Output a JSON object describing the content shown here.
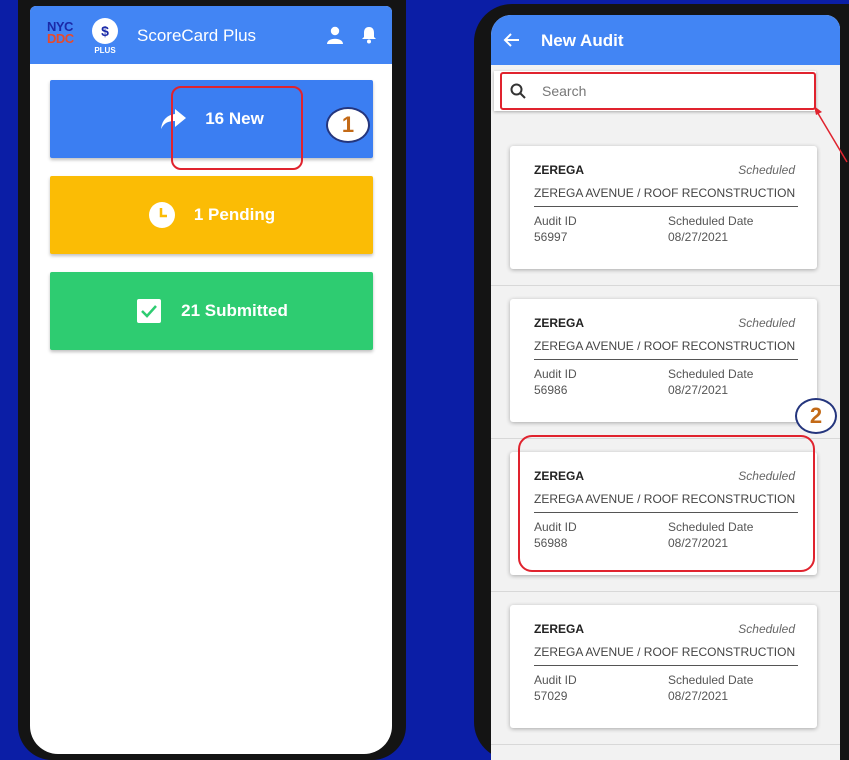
{
  "colors": {
    "background": "#0b1ea6",
    "header_blue": "#4285f4",
    "new_card": "#3b7ef2",
    "pending_card": "#fbbc05",
    "submitted_card": "#2ecc71",
    "callout_red": "#e0232e",
    "badge_number": "#c36a17"
  },
  "left": {
    "logo": {
      "line1": "NYC",
      "line2": "DDC"
    },
    "plus_logo": {
      "mark": "$",
      "label": "PLUS"
    },
    "app_title": "ScoreCard Plus",
    "cards": [
      {
        "icon": "share-arrow-icon",
        "label": "16 New"
      },
      {
        "icon": "clock-icon",
        "label": "1 Pending"
      },
      {
        "icon": "checkbox-icon",
        "label": "21 Submitted"
      }
    ],
    "badge": "1"
  },
  "right": {
    "title": "New Audit",
    "search": {
      "placeholder": "Search",
      "value": ""
    },
    "audits": [
      {
        "name": "ZEREGA",
        "status": "Scheduled",
        "project": "ZEREGA AVENUE / ROOF RECONSTRUCTION",
        "id_label": "Audit ID",
        "id": "56997",
        "date_label": "Scheduled Date",
        "date": "08/27/2021"
      },
      {
        "name": "ZEREGA",
        "status": "Scheduled",
        "project": "ZEREGA AVENUE / ROOF RECONSTRUCTION",
        "id_label": "Audit ID",
        "id": "56986",
        "date_label": "Scheduled Date",
        "date": "08/27/2021"
      },
      {
        "name": "ZEREGA",
        "status": "Scheduled",
        "project": "ZEREGA AVENUE / ROOF RECONSTRUCTION",
        "id_label": "Audit ID",
        "id": "56988",
        "date_label": "Scheduled Date",
        "date": "08/27/2021"
      },
      {
        "name": "ZEREGA",
        "status": "Scheduled",
        "project": "ZEREGA AVENUE / ROOF RECONSTRUCTION",
        "id_label": "Audit ID",
        "id": "57029",
        "date_label": "Scheduled Date",
        "date": "08/27/2021"
      }
    ],
    "badge": "2"
  }
}
